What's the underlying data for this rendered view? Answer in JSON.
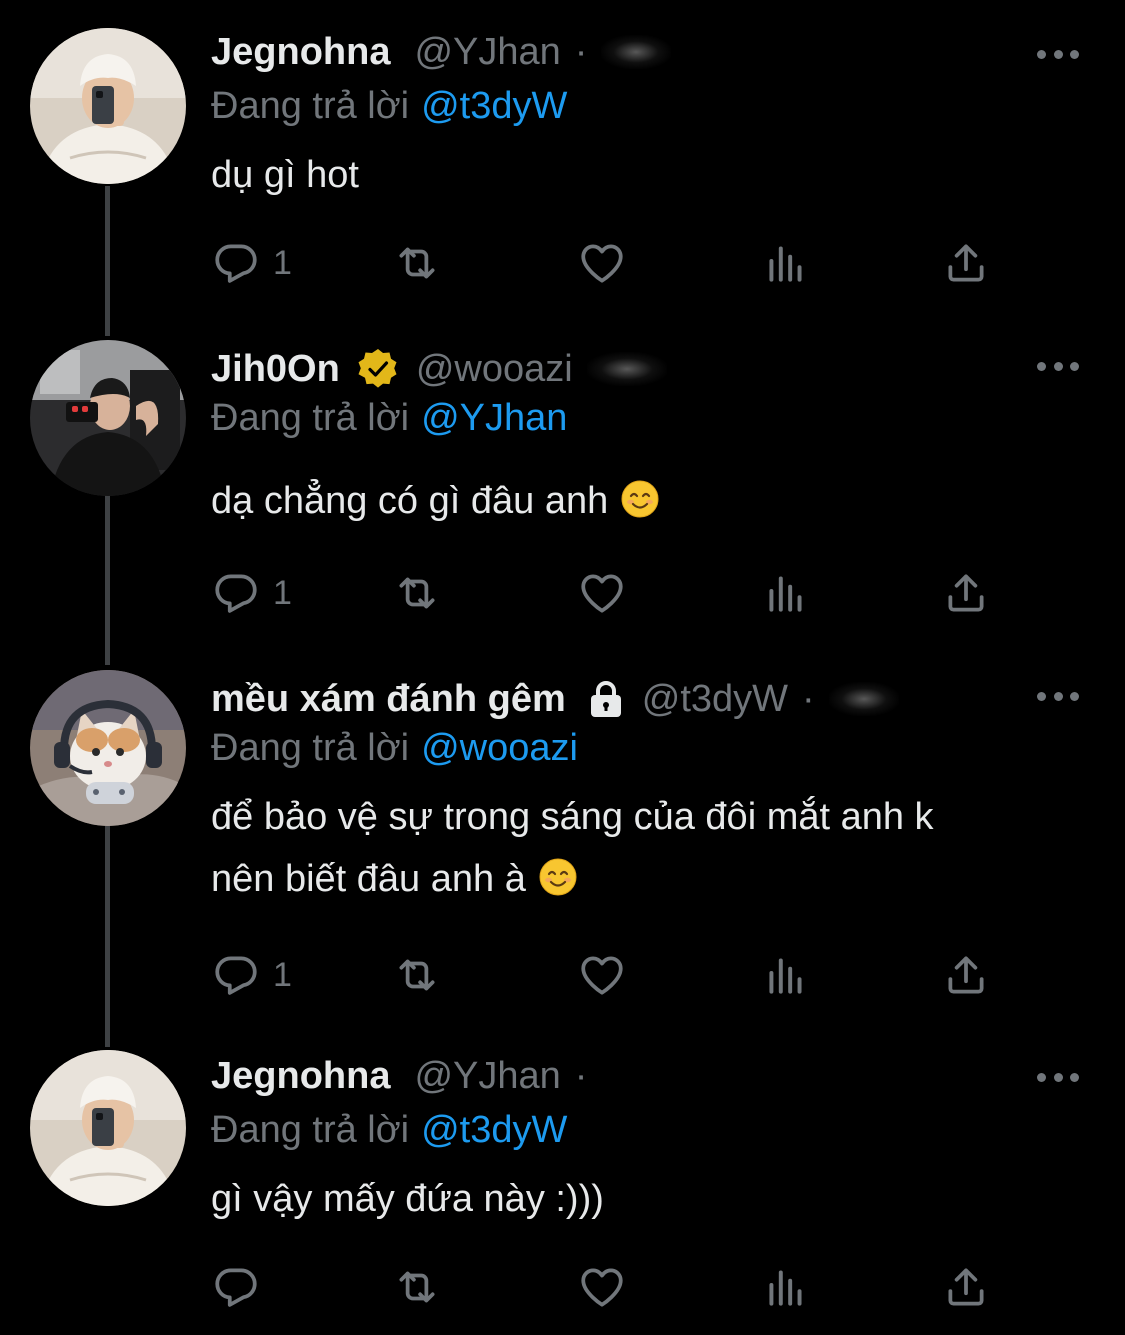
{
  "colors": {
    "background": "#000000",
    "text": "#E7E9EA",
    "muted": "#71767B",
    "link": "#1D9BF0",
    "verified": "#E2B719",
    "thread_line": "#3E4144"
  },
  "reply_prefix": "Đang trả lời",
  "tweets": [
    {
      "name": "Jegnohna",
      "handle": "@YJhan",
      "separator": "·",
      "reply_to": "@t3dyW",
      "text": "dụ gì hot",
      "reply_count": "1"
    },
    {
      "name": "Jih0On",
      "handle": "@wooazi",
      "badge": "verified-icon",
      "reply_to": "@YJhan",
      "text": "dạ chẳng có gì đâu anh",
      "emoji": "smiling-face-emoji",
      "reply_count": "1"
    },
    {
      "name": "mều xám đánh gêm",
      "handle": "@t3dyW",
      "badge": "lock-icon",
      "separator": "·",
      "reply_to": "@wooazi",
      "text_line1": "để bảo vệ sự trong sáng của đôi mắt anh k",
      "text_line2": "nên biết đâu anh à",
      "emoji": "smiling-face-emoji",
      "reply_count": "1"
    },
    {
      "name": "Jegnohna",
      "handle": "@YJhan",
      "separator": "·",
      "reply_to": "@t3dyW",
      "text": "gì vậy mấy đứa này :)))",
      "reply_count": ""
    }
  ],
  "icons": {
    "reply": "reply-icon",
    "retweet": "retweet-icon",
    "like": "heart-icon",
    "views": "views-icon",
    "share": "share-icon",
    "more": "more-icon"
  }
}
